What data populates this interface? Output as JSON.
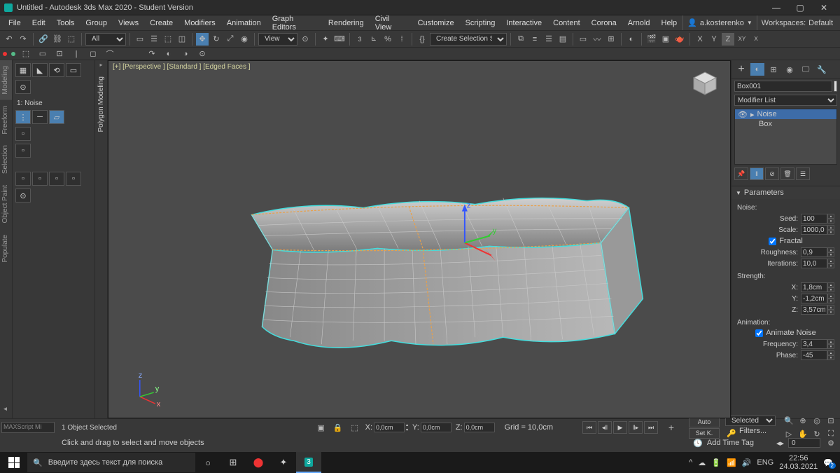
{
  "title": "Untitled - Autodesk 3ds Max 2020 - Student Version",
  "menu": [
    "File",
    "Edit",
    "Tools",
    "Group",
    "Views",
    "Create",
    "Modifiers",
    "Animation",
    "Graph Editors",
    "Rendering",
    "Civil View",
    "Customize",
    "Scripting",
    "Interactive",
    "Content",
    "Corona",
    "Arnold",
    "Help"
  ],
  "user": "a.kosterenko",
  "workspace_lbl": "Workspaces:",
  "workspace": "Default",
  "toolbar": {
    "all": "All",
    "view": "View",
    "createset": "Create Selection Set",
    "axes": [
      "X",
      "Y",
      "Z",
      "XY",
      "X"
    ]
  },
  "viewport_label": "[+] [Perspective ] [Standard ] [Edged Faces ]",
  "left_tabs": [
    "Modeling",
    "Freeform",
    "Selection",
    "Object Paint",
    "Populate"
  ],
  "poly_label": "Polygon Modeling",
  "mod_label": "1: Noise",
  "cmd": {
    "objname": "Box001",
    "modlist": "Modifier List",
    "stack": [
      {
        "label": "Noise",
        "active": true,
        "icon": "▸"
      },
      {
        "label": "Box",
        "active": false,
        "icon": ""
      }
    ],
    "rollout": "Parameters",
    "noise_lbl": "Noise:",
    "seed_lbl": "Seed:",
    "seed": "100",
    "scale_lbl": "Scale:",
    "scale": "1000,0",
    "fractal": "Fractal",
    "rough_lbl": "Roughness:",
    "rough": "0,9",
    "iter_lbl": "Iterations:",
    "iter": "10,0",
    "strength": "Strength:",
    "sx_lbl": "X:",
    "sx": "1,8cm",
    "sy_lbl": "Y:",
    "sy": "-1,2cm",
    "sz_lbl": "Z:",
    "sz": "3,57cm",
    "anim": "Animation:",
    "anim_noise": "Animate Noise",
    "freq_lbl": "Frequency:",
    "freq": "3,4",
    "phase_lbl": "Phase:",
    "phase": "-45"
  },
  "status": {
    "objsel": "1 Object Selected",
    "hint": "Click and drag to select and move objects",
    "maxscript": "MAXScript Mi",
    "x_lbl": "X:",
    "x": "0,0cm",
    "y_lbl": "Y:",
    "y": "0,0cm",
    "z_lbl": "Z:",
    "z": "0,0cm",
    "grid": "Grid = 10,0cm",
    "timetag": "Add Time Tag",
    "frame": "0",
    "auto": "Auto",
    "setk": "Set K.",
    "selected": "Selected",
    "filters": "Filters..."
  },
  "taskbar": {
    "search": "Введите здесь текст для поиска",
    "lang": "ENG",
    "time": "22:56",
    "date": "24.03.2021",
    "notif": "2"
  }
}
